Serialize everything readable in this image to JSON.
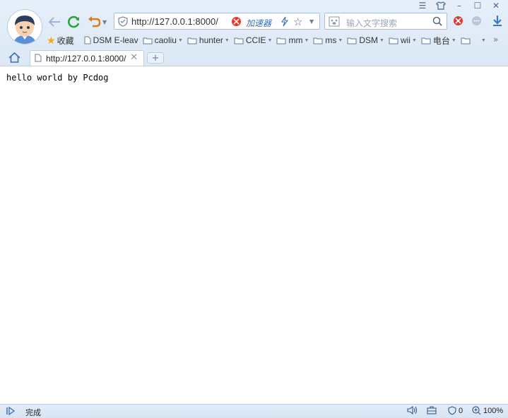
{
  "window": {
    "menu_icon": "menu-icon",
    "skin_icon": "shirt-icon",
    "minimize_icon": "minimize-icon",
    "maximize_icon": "maximize-icon",
    "close_icon": "close-icon"
  },
  "toolbar": {
    "url": "http://127.0.0.1:8000/",
    "accelerator_label": "加速器",
    "search_placeholder": "输入文字搜索"
  },
  "bookmarks": [
    {
      "label": "收藏",
      "icon": "star-icon"
    },
    {
      "label": "DSM E-leav",
      "icon": "page-icon"
    },
    {
      "label": "caoliu",
      "icon": "folder-icon"
    },
    {
      "label": "hunter",
      "icon": "folder-icon"
    },
    {
      "label": "CCIE",
      "icon": "folder-icon"
    },
    {
      "label": "mm",
      "icon": "folder-icon"
    },
    {
      "label": "ms",
      "icon": "folder-icon"
    },
    {
      "label": "DSM",
      "icon": "folder-icon"
    },
    {
      "label": "wii",
      "icon": "folder-icon"
    },
    {
      "label": "电台",
      "icon": "folder-icon"
    },
    {
      "label": "",
      "icon": "folder-icon"
    }
  ],
  "tabs": [
    {
      "title": "http://127.0.0.1:8000/"
    }
  ],
  "page": {
    "body_text": "hello world by Pcdog"
  },
  "status": {
    "text": "完成",
    "shield_count": "0",
    "zoom": "100%"
  }
}
